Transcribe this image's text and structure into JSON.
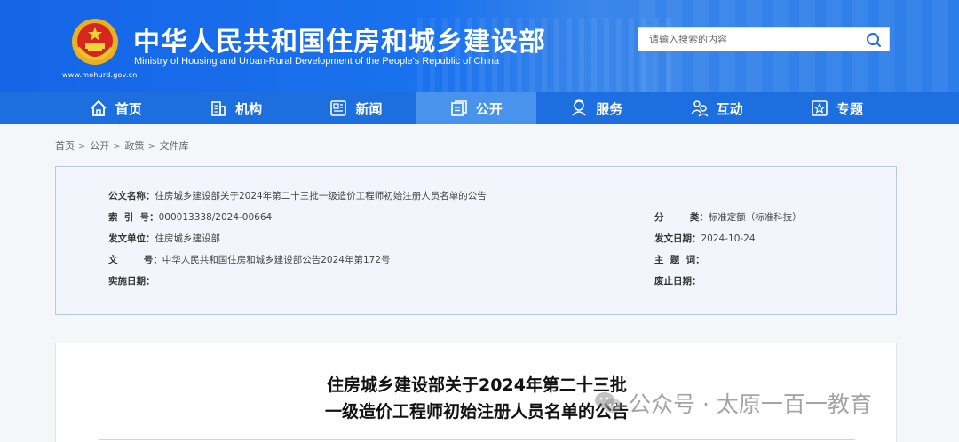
{
  "header": {
    "title": "中华人民共和国住房和城乡建设部",
    "subtitle": "Ministry of Housing and Urban-Rural Development of the People's Republic of China",
    "url": "www.mohurd.gov.cn",
    "search_placeholder": "请输入搜索的内容"
  },
  "nav": {
    "items": [
      {
        "label": "首页",
        "icon": "home-icon"
      },
      {
        "label": "机构",
        "icon": "building-icon"
      },
      {
        "label": "新闻",
        "icon": "news-icon"
      },
      {
        "label": "公开",
        "icon": "disclosure-icon",
        "active": true
      },
      {
        "label": "服务",
        "icon": "service-icon"
      },
      {
        "label": "互动",
        "icon": "interaction-icon"
      },
      {
        "label": "专题",
        "icon": "topic-icon"
      }
    ]
  },
  "breadcrumb": [
    "首页",
    "公开",
    "政策",
    "文件库"
  ],
  "info": {
    "title_key": "公文名称：",
    "title_val": "住房城乡建设部关于2024年第二十三批一级造价工程师初始注册人员名单的公告",
    "index_key": "索  引  号：",
    "index_val": "000013338/2024-00664",
    "category_key": "分        类：",
    "category_val": "标准定额（标准科技）",
    "issuer_key": "发文单位：",
    "issuer_val": "住房城乡建设部",
    "date_key": "发文日期：",
    "date_val": "2024-10-24",
    "docno_key": "文        号：",
    "docno_val": "中华人民共和国住房和城乡建设部公告2024年第172号",
    "subject_key": "主  题  词：",
    "subject_val": "",
    "effective_key": "实施日期：",
    "effective_val": "",
    "repeal_key": "废止日期：",
    "repeal_val": ""
  },
  "article": {
    "title_line1": "住房城乡建设部关于2024年第二十三批",
    "title_line2": "一级造价工程师初始注册人员名单的公告"
  },
  "watermark": {
    "text": "公众号 · 太原一百一教育"
  },
  "colors": {
    "header_blue": "#1a6fe8",
    "nav_blue": "#1d6fe0",
    "nav_active": "#4a93ec",
    "info_bg": "#f2f6fc"
  }
}
